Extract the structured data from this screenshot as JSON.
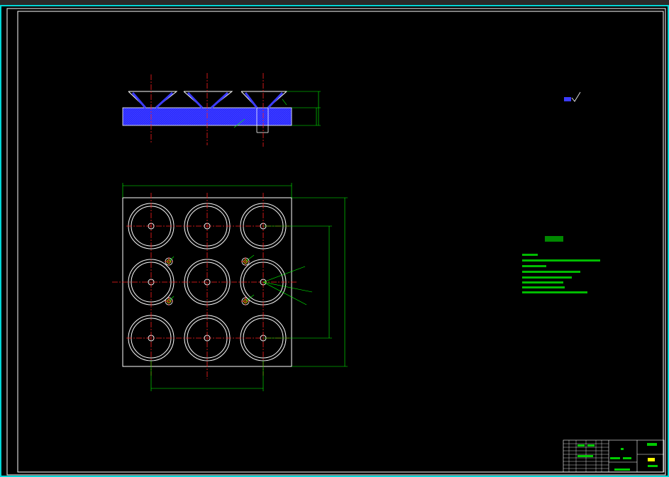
{
  "colors": {
    "background": "#000000",
    "outline": "#ffffff",
    "centerline": "#ff2020",
    "dimension": "#00ff00",
    "section_fill": "#2a2aff",
    "part_blue": "#3b3bff",
    "titleblock": "#00ffff",
    "accent_yellow": "#ffff00"
  },
  "roughness_symbol": "",
  "technical_requirements": {
    "title": "",
    "lines": []
  },
  "title_block": {
    "drawing_name": "",
    "scale": "",
    "material": "",
    "drawing_no": ""
  }
}
